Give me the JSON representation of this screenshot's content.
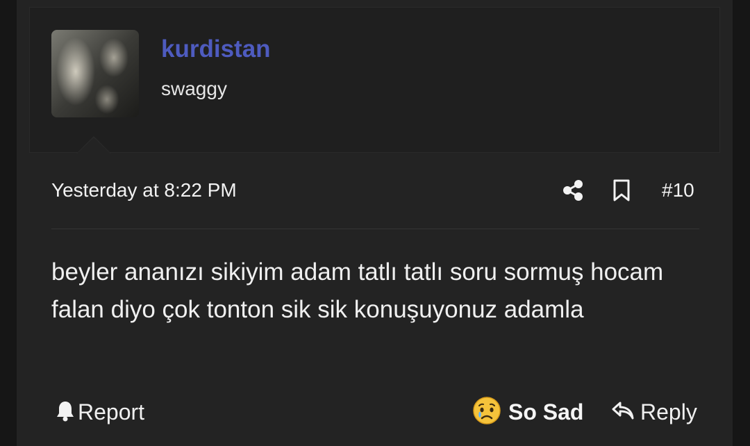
{
  "post": {
    "username": "kurdistan",
    "user_title": "swaggy",
    "date": "Yesterday at 8:22 PM",
    "number": "#10",
    "message": "beyler ananızı sikiyim adam tatlı tatlı soru sormuş hocam falan diyo çok tonton sik sik konuşuyonuz adamla"
  },
  "actions": {
    "report_label": "Report",
    "reaction_label": "So Sad",
    "reply_label": "Reply"
  },
  "icons": {
    "share": "share-icon",
    "bookmark": "bookmark-icon",
    "report": "bell-icon",
    "reaction": "sad-face-emoji",
    "reply": "reply-arrow-icon"
  },
  "colors": {
    "username": "#4e5bbf",
    "background": "#232323",
    "text": "#f0f0f0"
  }
}
